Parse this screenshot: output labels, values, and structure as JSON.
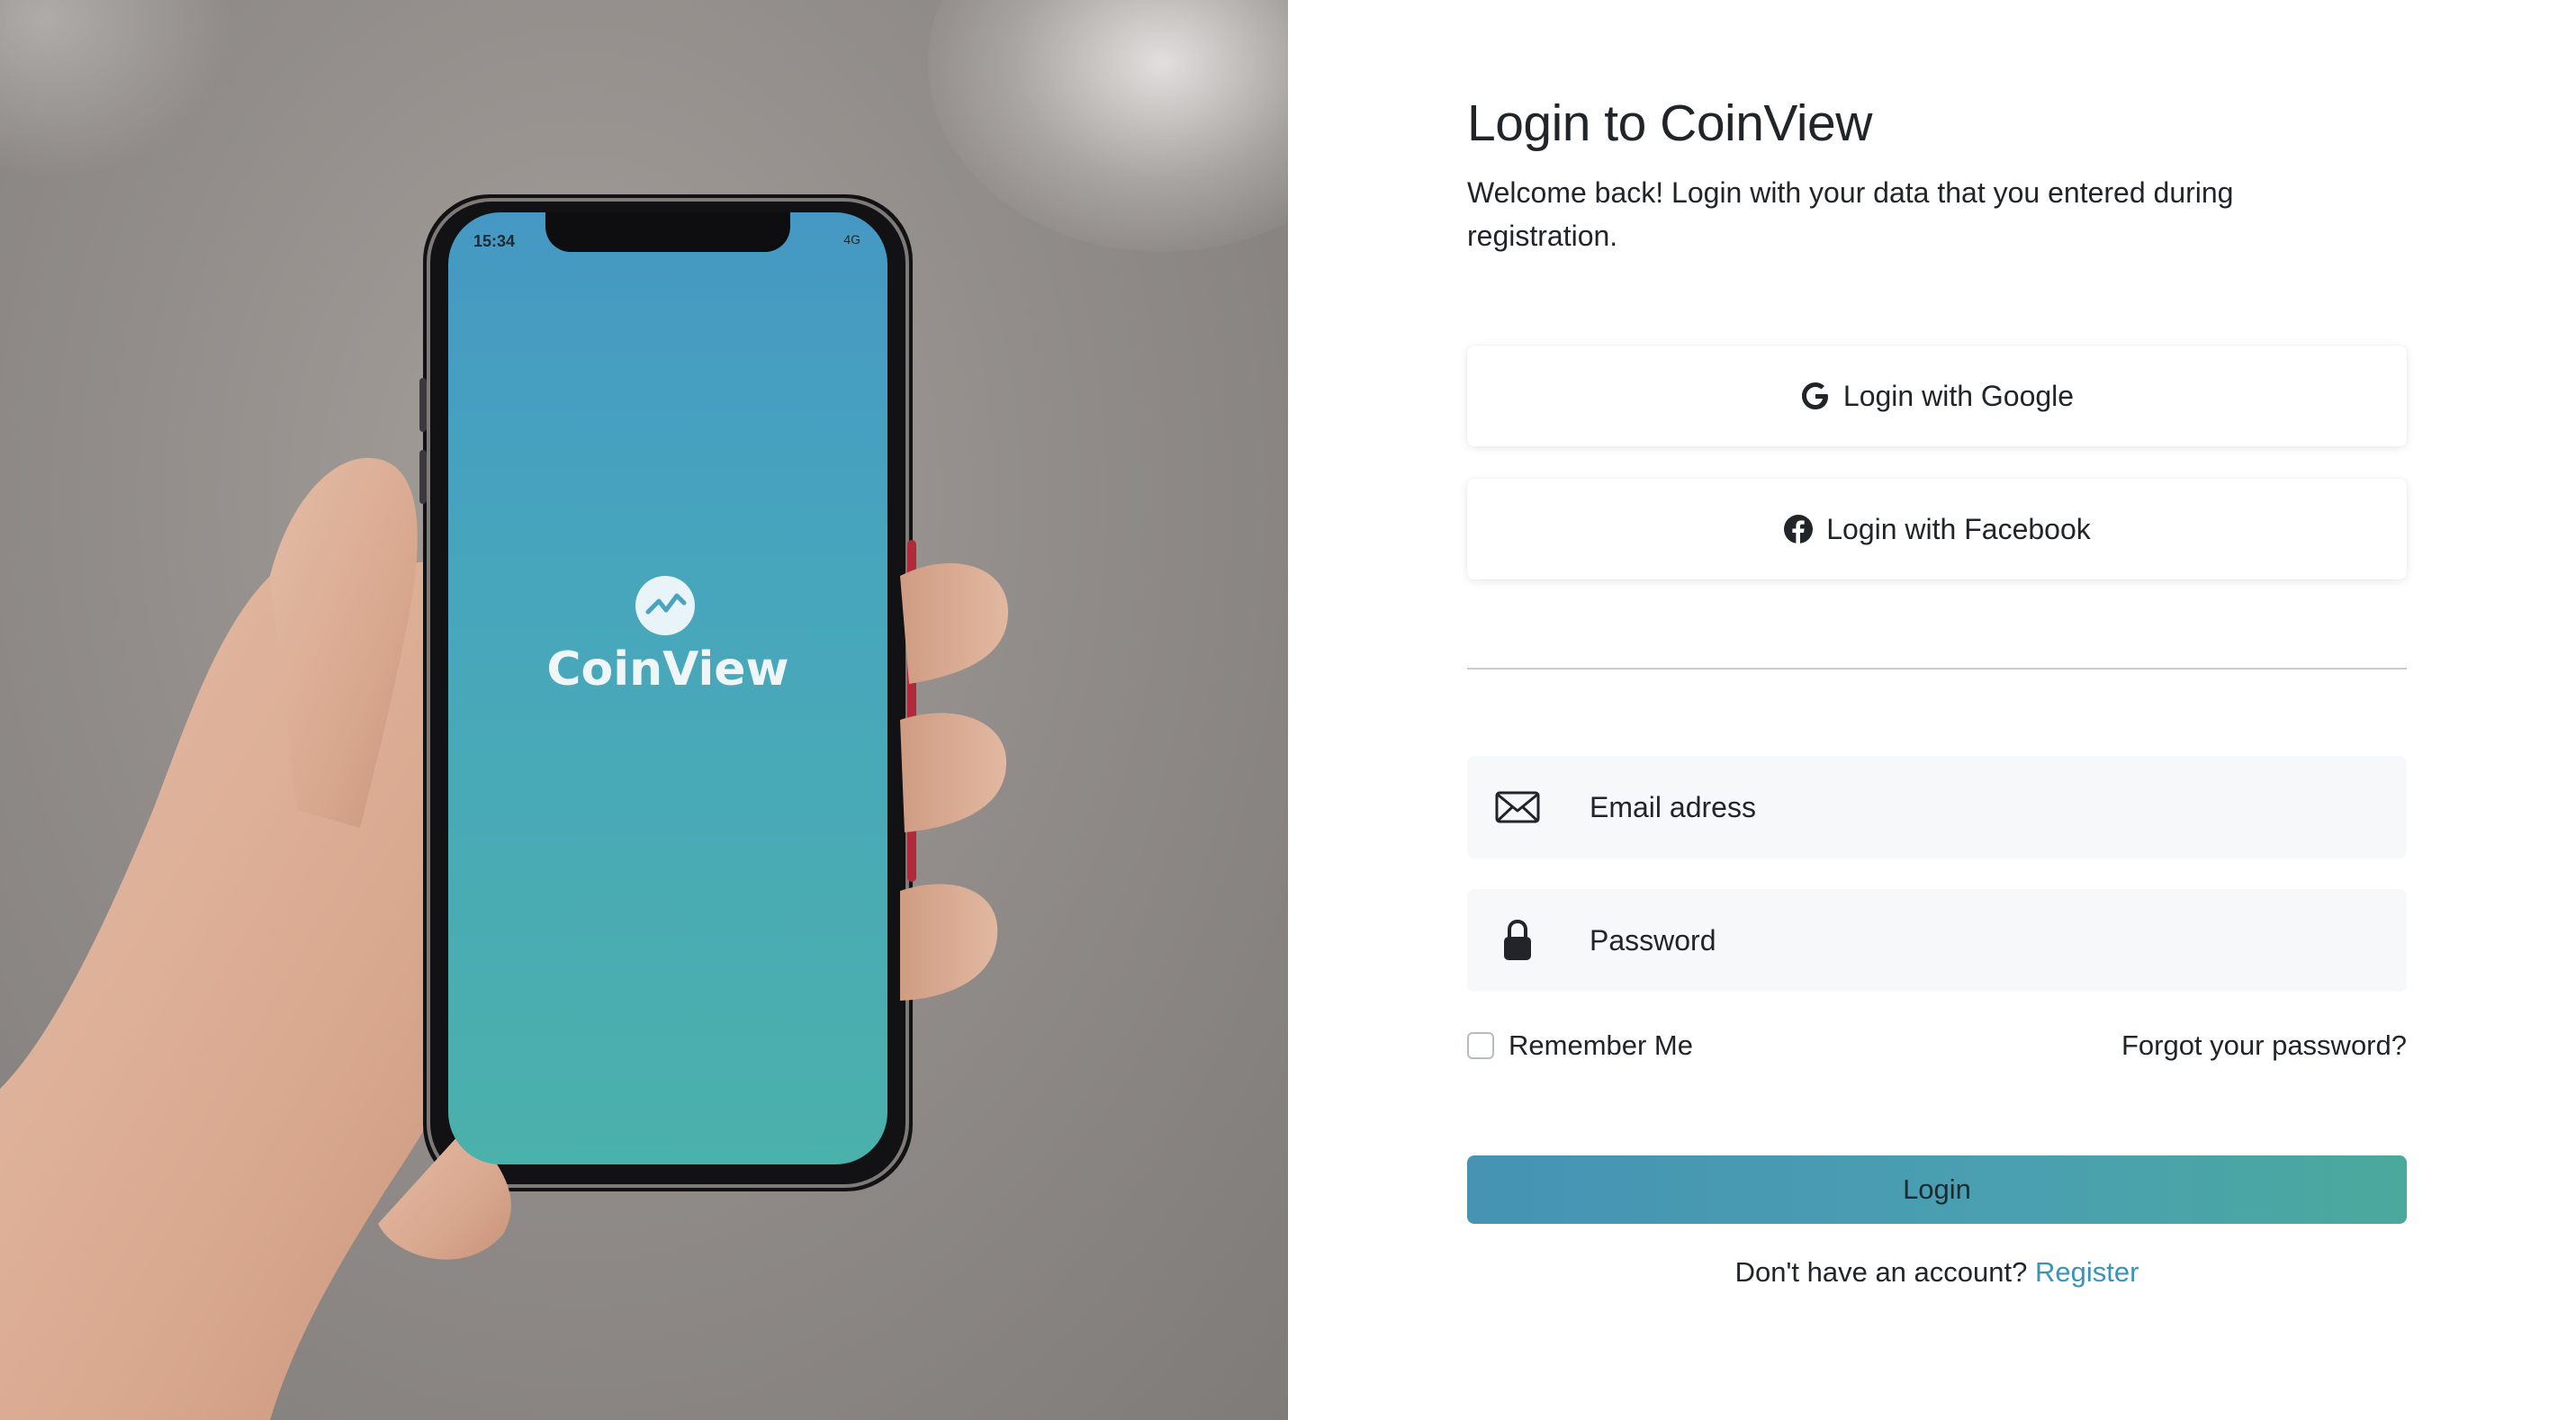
{
  "photo": {
    "app_name": "CoinView",
    "status_time": "15:34",
    "status_network": "4G"
  },
  "form": {
    "title": "Login to CoinView",
    "subtitle": "Welcome back! Login with your data that you entered during registration.",
    "google_label": "Login with Google",
    "facebook_label": "Login with Facebook",
    "email_placeholder": "Email adress",
    "password_placeholder": "Password",
    "remember_label": "Remember Me",
    "remember_checked": false,
    "forgot_label": "Forgot your password?",
    "login_label": "Login",
    "no_account_text": "Don't have an account?",
    "register_label": "Register"
  },
  "icons": {
    "google": "google-g-icon",
    "facebook": "facebook-icon",
    "email": "envelope-icon",
    "password": "lock-icon",
    "app_logo": "trend-chart-icon"
  },
  "colors": {
    "accent": "#3a94b8",
    "login_gradient_start": "#4693b4",
    "login_gradient_end": "#4aa99c",
    "field_background": "#f7f8f9",
    "text": "#212529"
  }
}
